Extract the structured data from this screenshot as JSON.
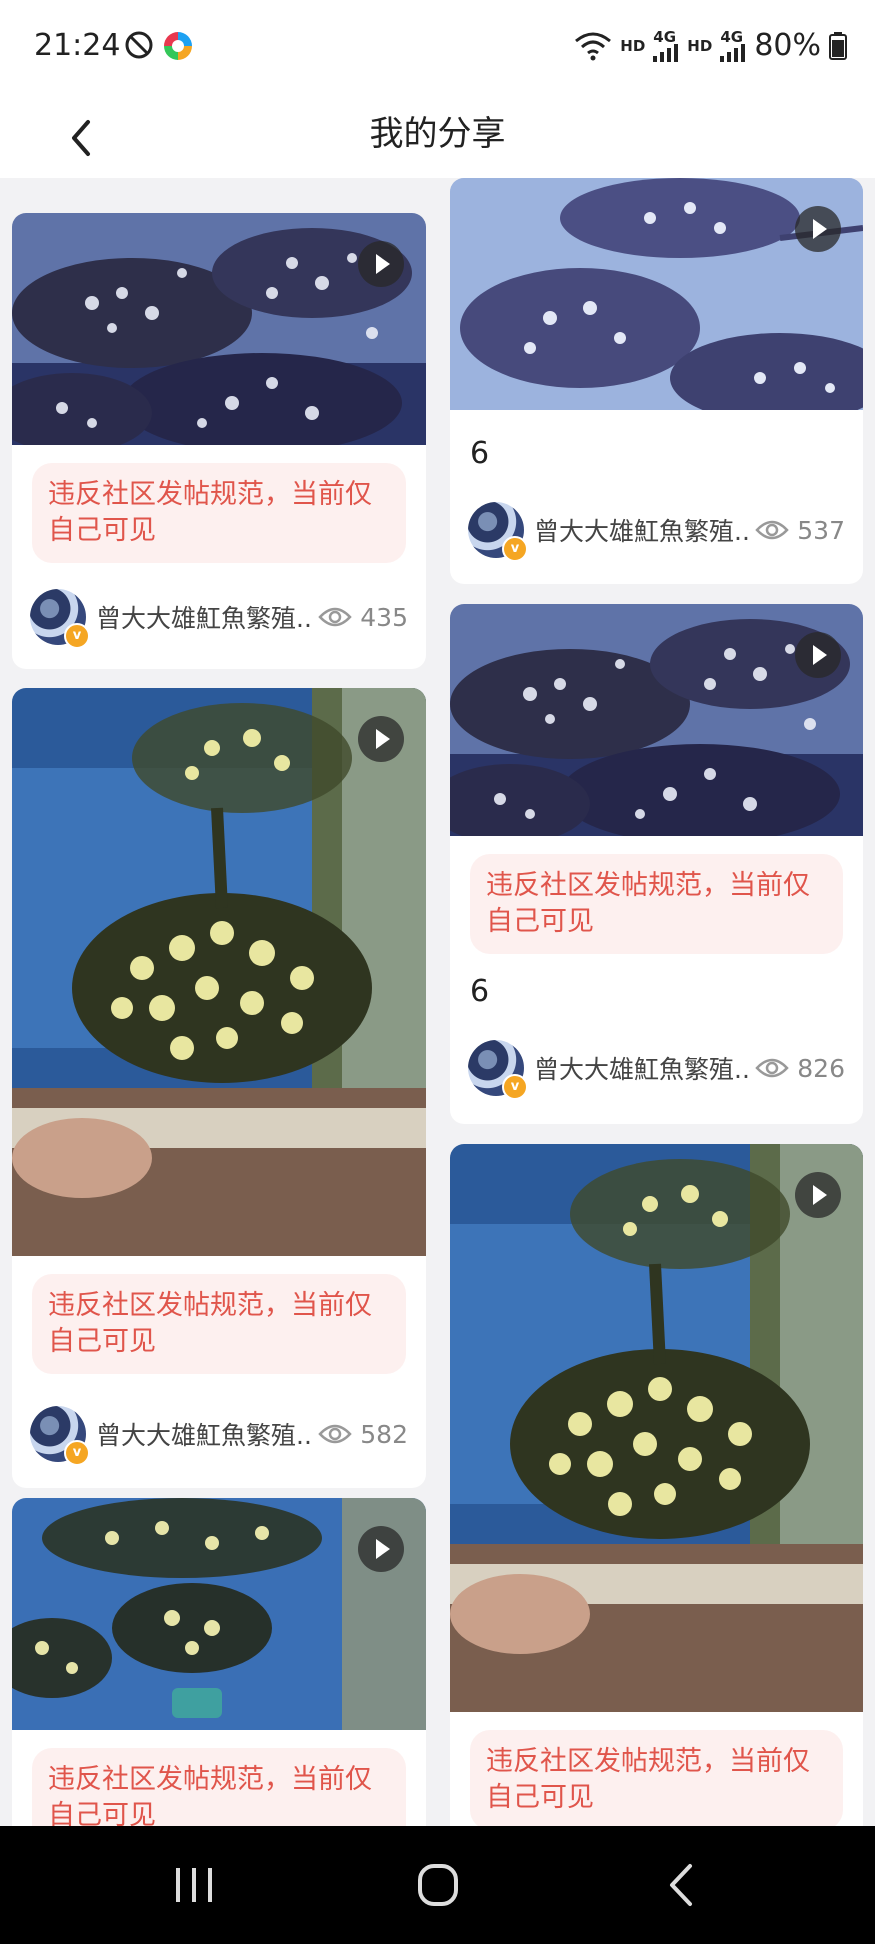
{
  "status_bar": {
    "time": "21:24",
    "hd1": "HD",
    "net1": "4G",
    "hd2": "HD",
    "net2": "4G",
    "battery": "80%",
    "icons": [
      "timer-icon",
      "app-icon",
      "wifi-icon",
      "signal-icon",
      "battery-icon"
    ]
  },
  "header": {
    "title": "我的分享",
    "back_icon": "chevron-left-icon"
  },
  "feed": {
    "left_column": [
      {
        "warning": "违反社区发帖规范，当前仅自己可见",
        "author": "曾大大雄魟魚繁殖...",
        "views": "435",
        "has_video": true
      },
      {
        "warning": "违反社区发帖规范，当前仅自己可见",
        "author": "曾大大雄魟魚繁殖...",
        "views": "582",
        "has_video": true
      },
      {
        "warning": "违反社区发帖规范，当前仅自己可见",
        "has_video": true
      }
    ],
    "right_column": [
      {
        "title": "6",
        "author": "曾大大雄魟魚繁殖...",
        "views": "537",
        "has_video": true
      },
      {
        "warning": "违反社区发帖规范，当前仅自己可见",
        "title": "6",
        "author": "曾大大雄魟魚繁殖...",
        "views": "826",
        "has_video": true
      },
      {
        "warning": "违反社区发帖规范，当前仅自己可见",
        "has_video": true
      }
    ]
  },
  "nav_bar": {
    "icons": [
      "recent-apps-icon",
      "home-icon",
      "back-icon"
    ]
  },
  "colors": {
    "warning_text": "#e0554b",
    "warning_bg": "#fdf0ef",
    "background": "#f2f2f4"
  }
}
